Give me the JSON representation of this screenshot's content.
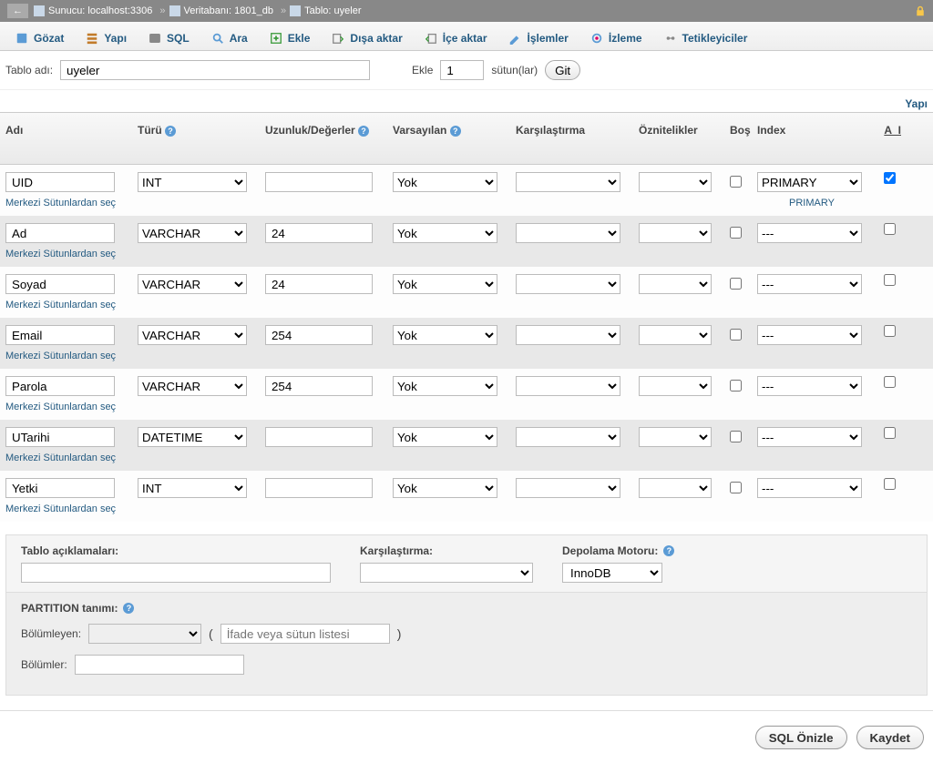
{
  "breadcrumb": {
    "back": "←",
    "server_label": "Sunucu: localhost:3306",
    "db_label": "Veritabanı: 1801_db",
    "table_label": "Tablo: uyeler",
    "sep": "»"
  },
  "tabs": [
    {
      "id": "browse",
      "label": "Gözat"
    },
    {
      "id": "structure",
      "label": "Yapı"
    },
    {
      "id": "sql",
      "label": "SQL"
    },
    {
      "id": "search",
      "label": "Ara"
    },
    {
      "id": "insert",
      "label": "Ekle"
    },
    {
      "id": "export",
      "label": "Dışa aktar"
    },
    {
      "id": "import",
      "label": "İçe aktar"
    },
    {
      "id": "operations",
      "label": "İşlemler"
    },
    {
      "id": "tracking",
      "label": "İzleme"
    },
    {
      "id": "triggers",
      "label": "Tetikleyiciler"
    }
  ],
  "tablename": {
    "label": "Tablo adı:",
    "value": "uyeler",
    "add_label": "Ekle",
    "cols_value": "1",
    "cols_suffix": "sütun(lar)",
    "go": "Git"
  },
  "right_tab_label": "Yapı",
  "headers": {
    "name": "Adı",
    "type": "Türü",
    "len": "Uzunluk/Değerler",
    "def": "Varsayılan",
    "coll": "Karşılaştırma",
    "attr": "Öznitelikler",
    "null": "Boş",
    "idx": "Index",
    "ai": "A_I"
  },
  "pick_central": "Merkezi Sütunlardan seç",
  "idx_primary_sub": "PRIMARY",
  "rows": [
    {
      "name": "UID",
      "type": "INT",
      "len": "",
      "def": "Yok",
      "coll": "",
      "attr": "",
      "null": false,
      "idx": "PRIMARY",
      "idx_sub": true,
      "ai": true
    },
    {
      "name": "Ad",
      "type": "VARCHAR",
      "len": "24",
      "def": "Yok",
      "coll": "",
      "attr": "",
      "null": false,
      "idx": "---",
      "idx_sub": false,
      "ai": false
    },
    {
      "name": "Soyad",
      "type": "VARCHAR",
      "len": "24",
      "def": "Yok",
      "coll": "",
      "attr": "",
      "null": false,
      "idx": "---",
      "idx_sub": false,
      "ai": false
    },
    {
      "name": "Email",
      "type": "VARCHAR",
      "len": "254",
      "def": "Yok",
      "coll": "",
      "attr": "",
      "null": false,
      "idx": "---",
      "idx_sub": false,
      "ai": false
    },
    {
      "name": "Parola",
      "type": "VARCHAR",
      "len": "254",
      "def": "Yok",
      "coll": "",
      "attr": "",
      "null": false,
      "idx": "---",
      "idx_sub": false,
      "ai": false
    },
    {
      "name": "UTarihi",
      "type": "DATETIME",
      "len": "",
      "def": "Yok",
      "coll": "",
      "attr": "",
      "null": false,
      "idx": "---",
      "idx_sub": false,
      "ai": false
    },
    {
      "name": "Yetki",
      "type": "INT",
      "len": "",
      "def": "Yok",
      "coll": "",
      "attr": "",
      "null": false,
      "idx": "---",
      "idx_sub": false,
      "ai": false
    }
  ],
  "bottom": {
    "comments_label": "Tablo açıklamaları:",
    "collation_label": "Karşılaştırma:",
    "engine_label": "Depolama Motoru:",
    "engine_value": "InnoDB",
    "partition_label": "PARTITION tanımı:",
    "partition_by": "Bölümleyen:",
    "expr_placeholder": "İfade veya sütun listesi",
    "sections": "Bölümler:"
  },
  "footer": {
    "preview": "SQL Önizle",
    "save": "Kaydet"
  }
}
